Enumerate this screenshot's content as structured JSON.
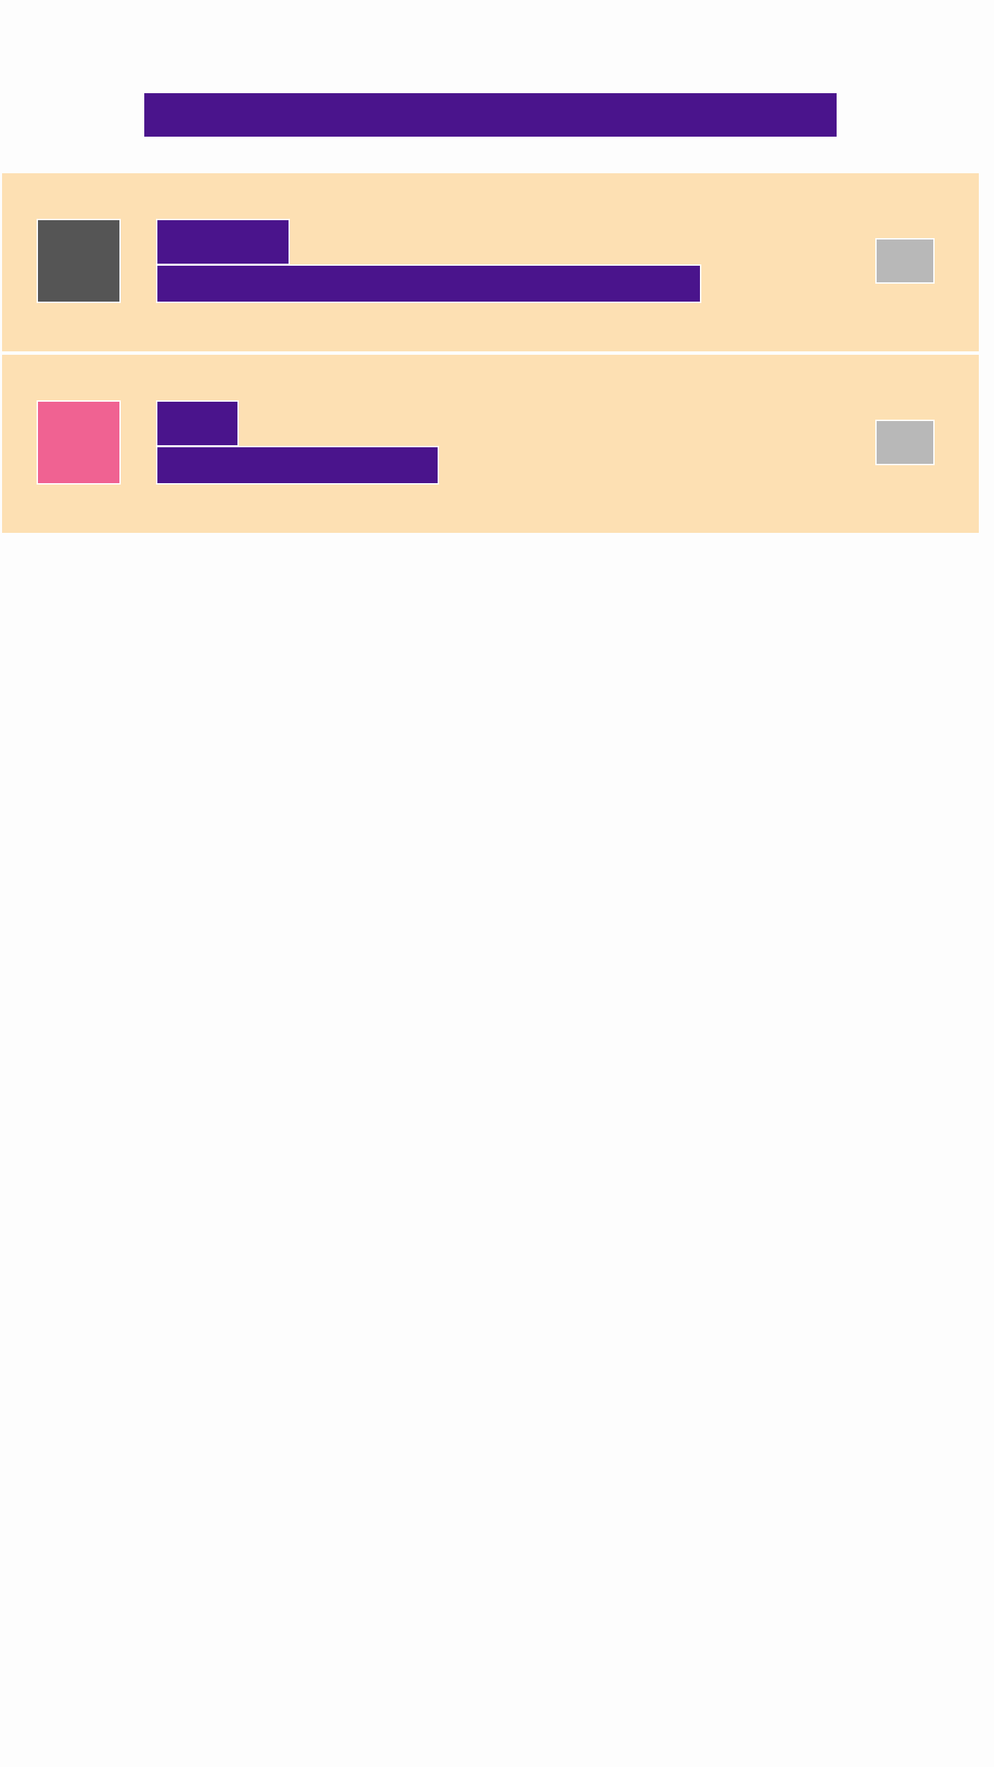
{
  "header": {
    "title": ""
  },
  "list": {
    "items": [
      {
        "thumbnail_color": "#555555",
        "title": "",
        "subtitle": "",
        "action_label": ""
      },
      {
        "thumbnail_color": "#f06292",
        "title": "",
        "subtitle": "",
        "action_label": ""
      }
    ]
  },
  "colors": {
    "background": "#fdfdfd",
    "accent": "#4a148c",
    "card": "#fde0b3",
    "button": "#b8b8b8",
    "border": "#ffffff"
  }
}
